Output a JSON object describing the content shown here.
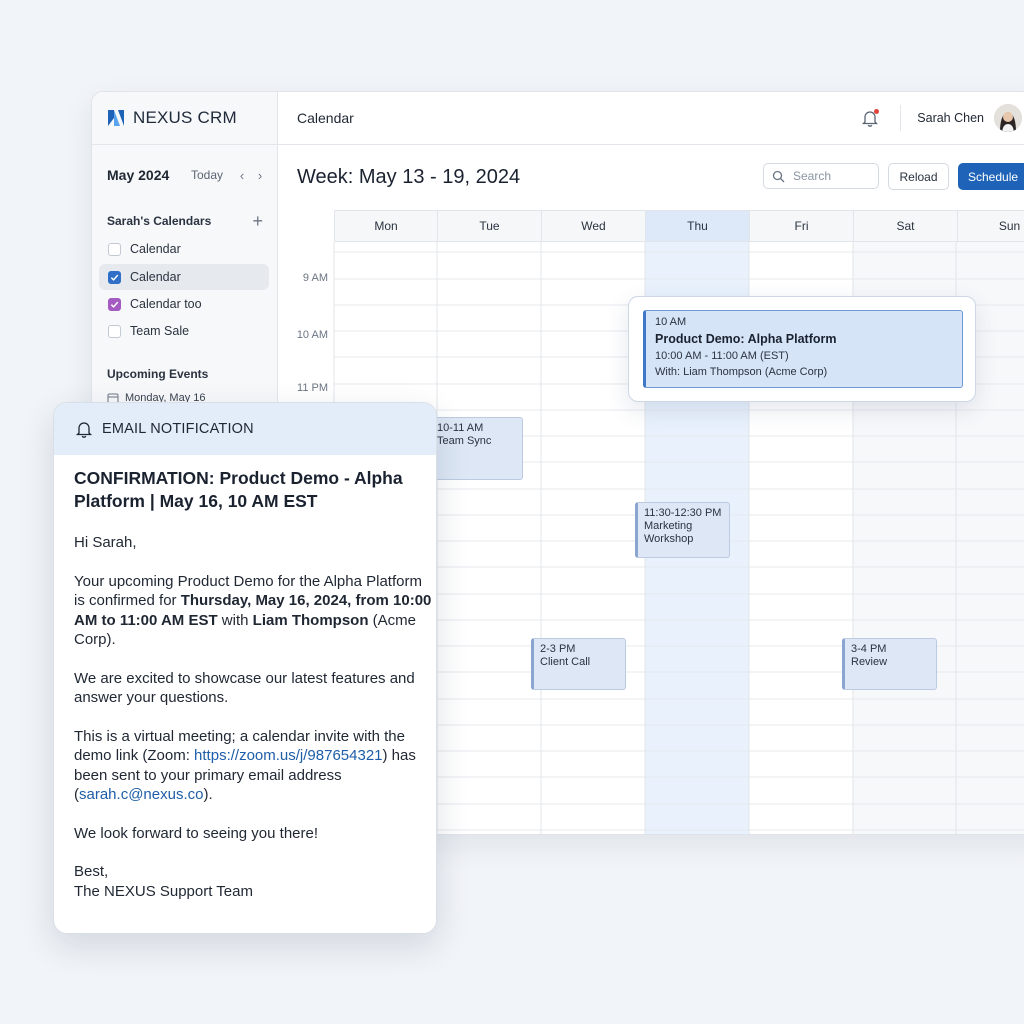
{
  "app": {
    "brand": "NEXUS CRM"
  },
  "header": {
    "title": "Calendar",
    "user_name": "Sarah Chen"
  },
  "sidebar": {
    "month": "May 2024",
    "today_label": "Today",
    "calendars_title": "Sarah's Calendars",
    "calendars": [
      {
        "label": "Calendar",
        "checked": false
      },
      {
        "label": "Calendar",
        "checked": true,
        "color": "#2f6fc8"
      },
      {
        "label": "Calendar too",
        "checked": true,
        "color": "#a45cc2"
      },
      {
        "label": "Team Sale",
        "checked": false
      }
    ],
    "upcoming_title": "Upcoming Events",
    "upcoming_item": "Monday, May 16"
  },
  "toolbar": {
    "week_title": "Week: May 13 - 19, 2024",
    "search_placeholder": "Search",
    "reload_label": "Reload",
    "schedule_label": "Schedule"
  },
  "week": {
    "days": [
      "Mon",
      "Tue",
      "Wed",
      "Thu",
      "Fri",
      "Sat",
      "Sun"
    ],
    "today": "Thu",
    "time_labels": [
      "9 AM",
      "10 AM",
      "11 PM"
    ],
    "events": [
      {
        "day": "Mon",
        "time": "10-11 AM",
        "title": "Team Sync"
      },
      {
        "day": "Wed",
        "time": "11:30-12:30 PM",
        "title": "Marketing Workshop"
      },
      {
        "day": "Tue",
        "time": "2-3 PM",
        "title": "Client Call"
      },
      {
        "day": "Fri",
        "time": "3-4 PM",
        "title": "Review"
      }
    ]
  },
  "popover": {
    "time": "10 AM",
    "title": "Product Demo: Alpha Platform",
    "range": "10:00 AM - 11:00 AM (EST)",
    "with": "With: Liam Thompson (Acme Corp)"
  },
  "email": {
    "header": "EMAIL NOTIFICATION",
    "subject": "CONFIRMATION: Product Demo - Alpha Platform | May 16, 10 AM EST",
    "greeting": "Hi Sarah,",
    "p1_a": "Your upcoming Product Demo for the Alpha Platform is confirmed for ",
    "p1_b": "Thursday, May 16, 2024, from 10:00 AM to 11:00 AM EST",
    "p1_c": " with ",
    "p1_d": "Liam Thompson",
    "p1_e": " (Acme Corp).",
    "p2": "We are excited to showcase our latest features and answer your questions.",
    "p3_a": "This is a virtual meeting; a calendar invite with the demo link (Zoom: ",
    "p3_link": "https://zoom.us/j/987654321",
    "p3_b": ") has been sent to your primary email address (",
    "p3_email": "sarah.c@nexus.co",
    "p3_c": ").",
    "p4": "We look forward to seeing you there!",
    "sign_1": "Best,",
    "sign_2": "The NEXUS Support Team"
  },
  "colors": {
    "accent": "#1e63b8",
    "today_column": "#e8f1fc",
    "event_fill": "#dde7f5"
  }
}
